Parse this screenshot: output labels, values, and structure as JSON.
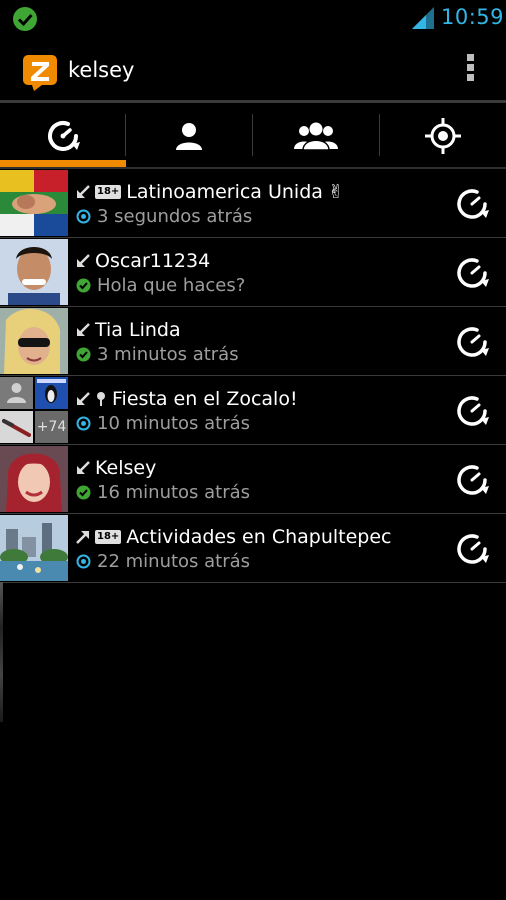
{
  "status_bar": {
    "time": "10:59"
  },
  "action_bar": {
    "title": "kelsey"
  },
  "tabs": [
    {
      "name": "recent",
      "icon": "recent-icon"
    },
    {
      "name": "person",
      "icon": "person-icon"
    },
    {
      "name": "group",
      "icon": "group-icon"
    },
    {
      "name": "location",
      "icon": "location-target-icon"
    }
  ],
  "colors": {
    "accent": "#f08a00",
    "clock": "#33b5e5",
    "online": "#3fa535",
    "group": "#33b5e5"
  },
  "rows": [
    {
      "title": "Latinoamerica Unida",
      "badge": "18+",
      "status": "3 segundos atrás"
    },
    {
      "title": "Oscar11234",
      "status": "Hola que haces?"
    },
    {
      "title": "Tia Linda",
      "status": "3 minutos atrás"
    },
    {
      "title": "Fiesta en el Zocalo!",
      "status": "10 minutos atrás",
      "more_count": "+74"
    },
    {
      "title": "Kelsey",
      "status": "16 minutos atrás"
    },
    {
      "title": "Actividades en Chapultepec",
      "badge": "18+",
      "status": "22 minutos atrás"
    }
  ]
}
